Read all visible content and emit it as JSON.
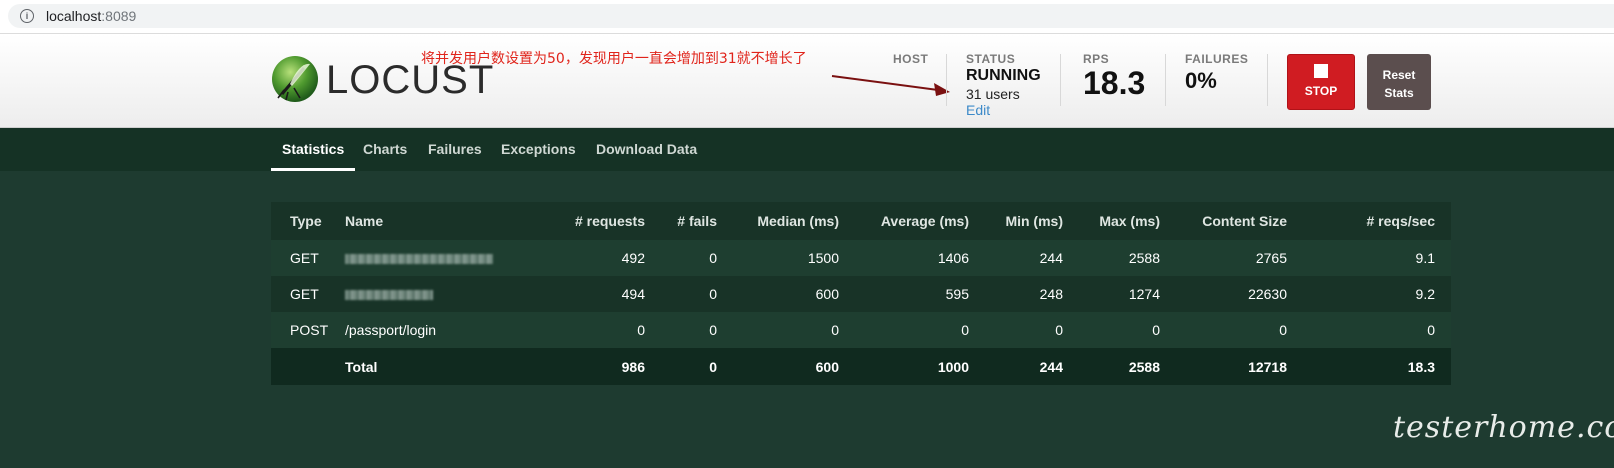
{
  "browser": {
    "host": "localhost",
    "port": ":8089"
  },
  "header": {
    "logo_text": "LOCUST",
    "annotation": "将并发用户数设置为50，发现用户一直会增加到31就不增长了",
    "host_label": "HOST",
    "status_label": "STATUS",
    "status_value": "RUNNING",
    "users": "31 users",
    "edit": "Edit",
    "rps_label": "RPS",
    "rps_value": "18.3",
    "failures_label": "FAILURES",
    "failures_value": "0%",
    "stop_label": "STOP",
    "reset_label_1": "Reset",
    "reset_label_2": "Stats"
  },
  "tabs": [
    "Statistics",
    "Charts",
    "Failures",
    "Exceptions",
    "Download Data"
  ],
  "table": {
    "headers": [
      "Type",
      "Name",
      "# requests",
      "# fails",
      "Median (ms)",
      "Average (ms)",
      "Min (ms)",
      "Max (ms)",
      "Content Size",
      "# reqs/sec"
    ],
    "rows": [
      [
        "GET",
        "",
        "492",
        "0",
        "1500",
        "1406",
        "244",
        "2588",
        "2765",
        "9.1"
      ],
      [
        "GET",
        "",
        "494",
        "0",
        "600",
        "595",
        "248",
        "1274",
        "22630",
        "9.2"
      ],
      [
        "POST",
        "/passport/login",
        "0",
        "0",
        "0",
        "0",
        "0",
        "0",
        "0",
        "0"
      ]
    ],
    "total": [
      "",
      "Total",
      "986",
      "0",
      "600",
      "1000",
      "244",
      "2588",
      "12718",
      "18.3"
    ]
  },
  "colors": {
    "page_bg": "#1e3b30",
    "stop": "#d01c22",
    "reset": "#5b4e4e",
    "link": "#3d8ac9",
    "annotation": "#e0241b"
  },
  "watermark": "testerhome.com"
}
